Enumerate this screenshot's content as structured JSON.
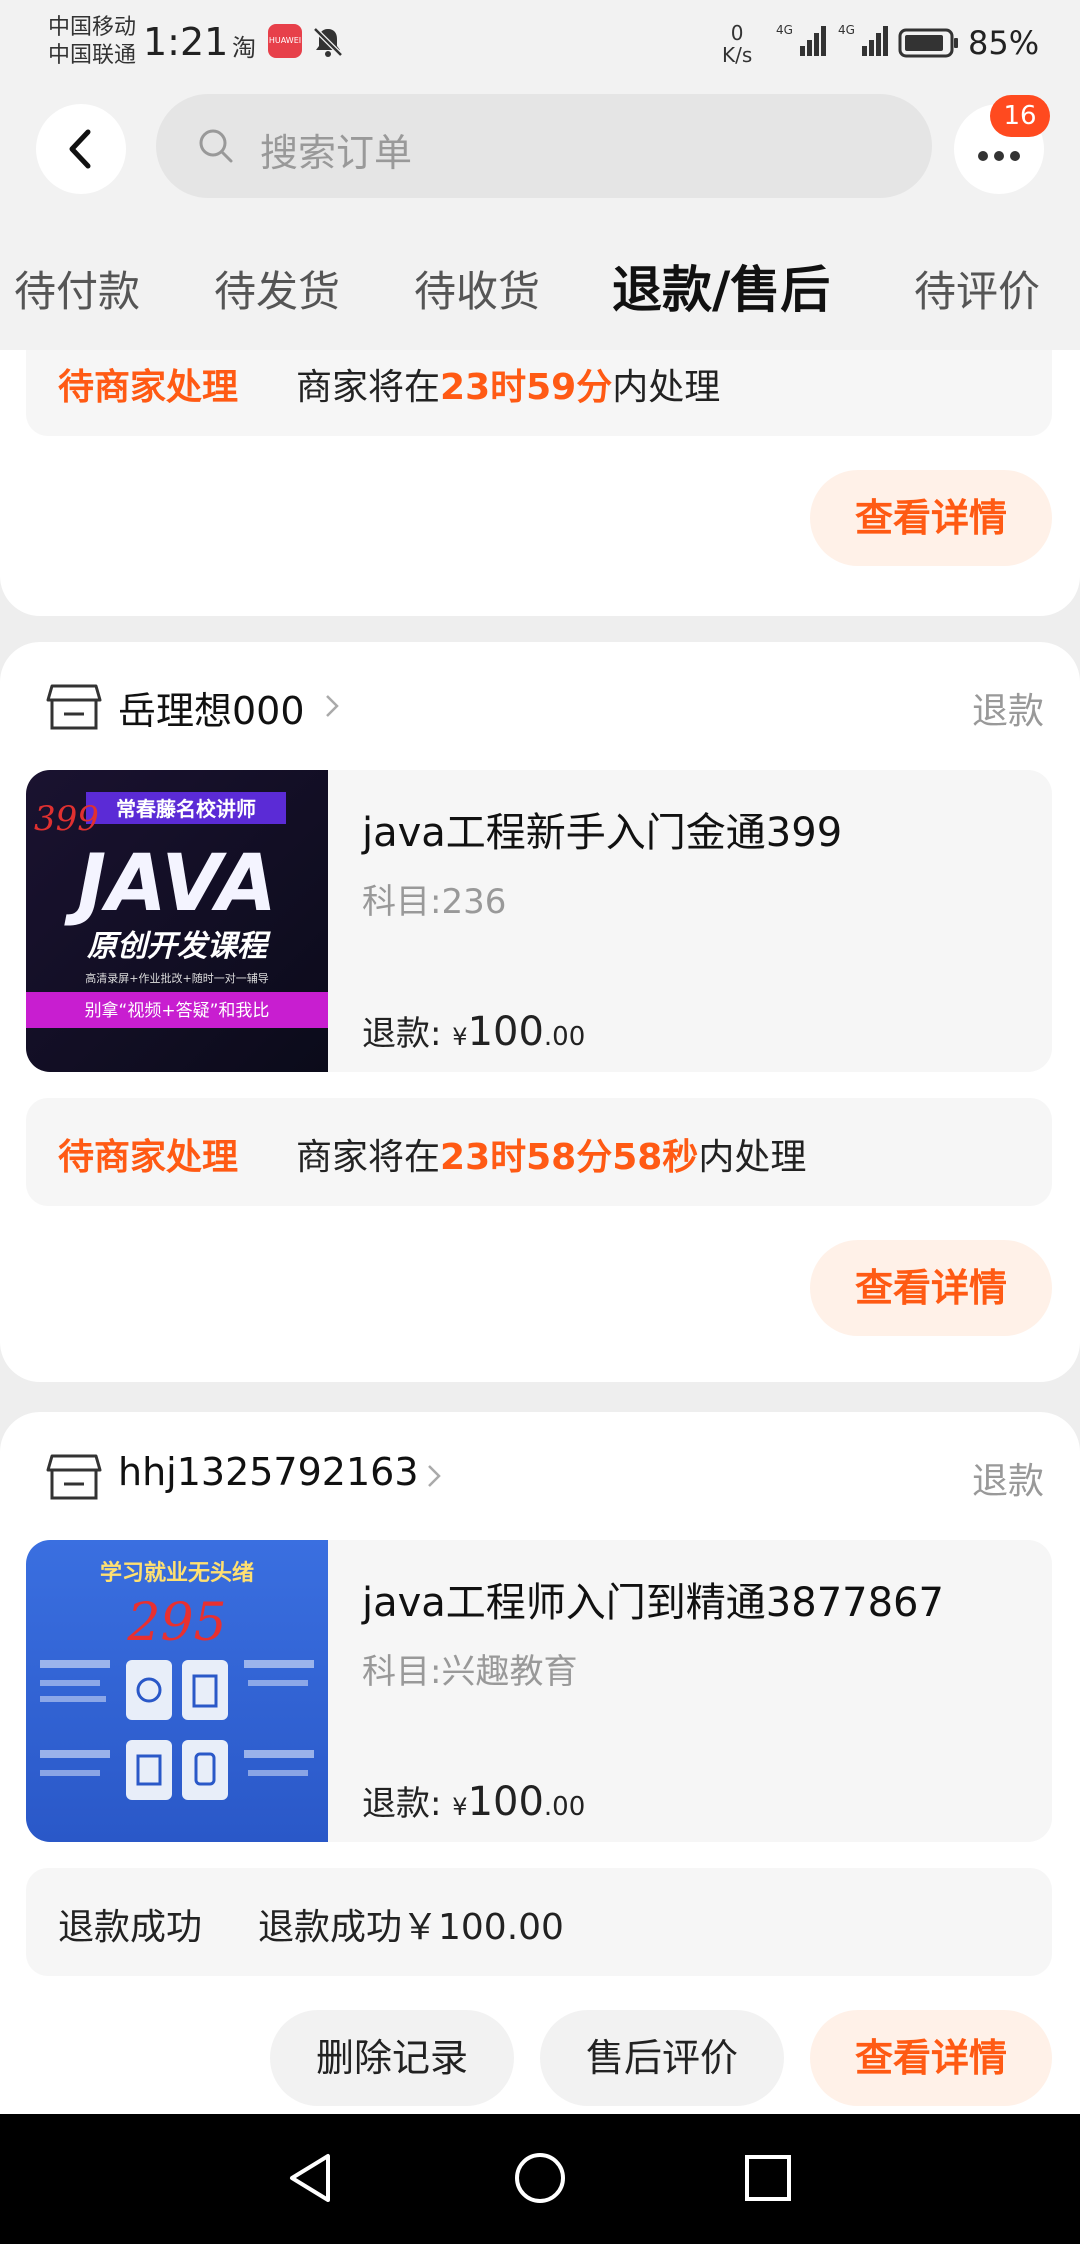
{
  "status_bar": {
    "carrier1": "中国移动",
    "carrier2": "中国联通",
    "time": "1:21",
    "taobao_glyph": "淘",
    "huawei_label": "HUAWEI",
    "net_speed_value": "0",
    "net_speed_unit": "K/s",
    "sig1": "4G",
    "sig2": "4G",
    "battery": "85%"
  },
  "header": {
    "search_placeholder": "搜索订单",
    "badge": "16"
  },
  "tabs": [
    {
      "label": "待付款"
    },
    {
      "label": "待发货"
    },
    {
      "label": "待收货"
    },
    {
      "label": "退款/售后",
      "active": true
    },
    {
      "label": "待评价"
    }
  ],
  "card0": {
    "status_label": "待商家处理",
    "msg_prefix": "商家将在",
    "msg_highlight": "23时59分",
    "msg_suffix": "内处理",
    "button": "查看详情"
  },
  "card1": {
    "store": "岳理想000",
    "refund_type": "退款",
    "product_title": "java工程新手入门金通399",
    "product_subject": "科目:236",
    "price_label": "退款:",
    "currency": "¥",
    "price_int": "100",
    "price_dec": ".00",
    "status_label": "待商家处理",
    "msg_prefix": "商家将在",
    "msg_highlight": "23时58分58秒",
    "msg_suffix": "内处理",
    "button": "查看详情",
    "thumb": {
      "scrawl": "399",
      "top": "常春藤名校讲师",
      "big": "JAVA",
      "sub": "原创开发课程",
      "small": "高清录屏+作业批改+随时一对一辅导",
      "bottom": "别拿“视频+答疑”和我比"
    }
  },
  "card2": {
    "store": "hhj1325792163",
    "refund_type": "退款",
    "product_title": "java工程师入门到精通3877867",
    "product_subject": "科目:兴趣教育",
    "price_label": "退款:",
    "currency": "¥",
    "price_int": "100",
    "price_dec": ".00",
    "status_label": "退款成功",
    "status_msg": "退款成功￥100.00",
    "btn_delete": "删除记录",
    "btn_review": "售后评价",
    "btn_detail": "查看详情",
    "thumb": {
      "top": "学习就业无头绪",
      "num": "295"
    }
  },
  "colors": {
    "accent": "#ff5a14",
    "badge": "#ff4a1f",
    "background": "#eeeeee"
  }
}
